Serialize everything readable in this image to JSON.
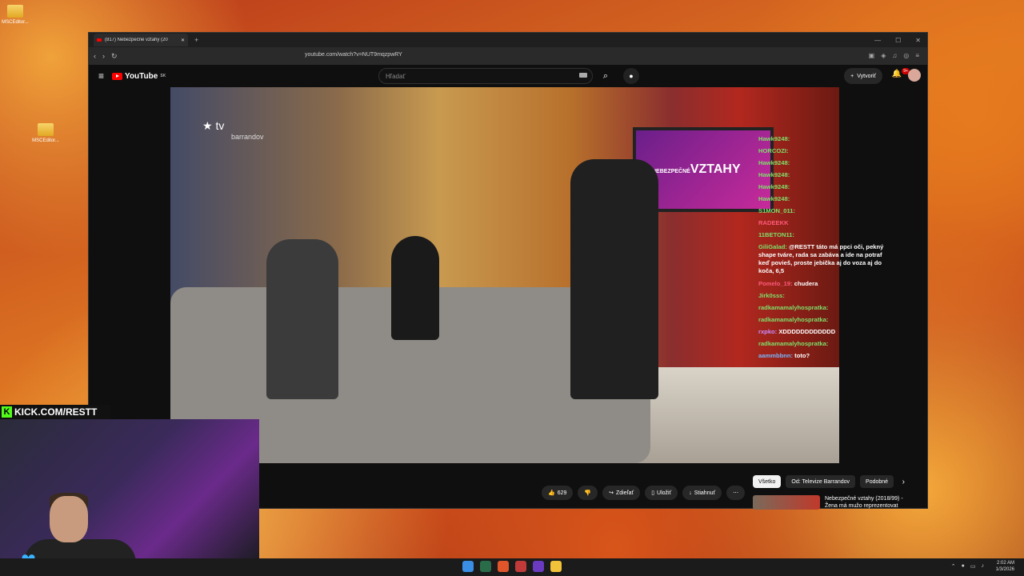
{
  "desktop": {
    "icons": [
      {
        "label": "MSCEditor..."
      },
      {
        "label": "MSCEditor..."
      }
    ]
  },
  "browser": {
    "tab_title": "(817) Nebezpečné vztahy (20",
    "url": "youtube.com/watch?v=NUT9mqzpwRY"
  },
  "youtube": {
    "logo_text": "YouTube",
    "region": "SK",
    "search_placeholder": "Hľadať",
    "create_label": "Vytvoriť",
    "notif_count": "9+",
    "video_overlay": {
      "channel_logo": "tv",
      "channel_sub": "barrandov",
      "screen_text": "VZTAHY",
      "screen_prefix": "NEBEZPEČNÉ"
    },
    "actions": {
      "likes": "629",
      "share": "Zdieľať",
      "save": "Uložiť",
      "download": "Stiahnuť"
    },
    "chips": [
      "Všetko",
      "Od: Televize Barrandov",
      "Podobné"
    ],
    "recommended": {
      "title": "Nebezpečné vztahy (2018/99) - Žena má mužo reprezentovat"
    }
  },
  "chat": [
    {
      "user": "Hawk9248:",
      "msg": "",
      "color": "green"
    },
    {
      "user": "HORCOZI:",
      "msg": "",
      "color": "green"
    },
    {
      "user": "Hawk9248:",
      "msg": "",
      "color": "green"
    },
    {
      "user": "Hawk9248:",
      "msg": "",
      "color": "green"
    },
    {
      "user": "Hawk9248:",
      "msg": "",
      "color": "green"
    },
    {
      "user": "Hawk9248:",
      "msg": "",
      "color": "green"
    },
    {
      "user": "S1MON_011:",
      "msg": "",
      "color": "green"
    },
    {
      "user": "RADEEKK",
      "msg": "",
      "color": "red"
    },
    {
      "user": "11BETON11:",
      "msg": "",
      "color": "green"
    },
    {
      "user": "GiliGalad:",
      "msg": "@RESTT táto má ppci oči, pekný shape tváre, rada sa zabáva a ide na potraf keď povieš, proste jebička aj do voza aj do koča, 6,5",
      "color": "green"
    },
    {
      "user": "Pomelo_19:",
      "msg": "chudera",
      "color": "red"
    },
    {
      "user": "Jirk0sss:",
      "msg": "",
      "color": "green"
    },
    {
      "user": "radkamamalyhospratka:",
      "msg": "",
      "color": "green"
    },
    {
      "user": "radkamamalyhospratka:",
      "msg": "",
      "color": "green"
    },
    {
      "user": "rxpko:",
      "msg": "XDDDDDDDDDDDD",
      "color": "purple"
    },
    {
      "user": "radkamamalyhospratka:",
      "msg": "",
      "color": "green"
    },
    {
      "user": "aammbbnn:",
      "msg": "toto?",
      "color": "blue"
    }
  ],
  "stream": {
    "kick_url": "KICK.COM/RESTT"
  },
  "taskbar": {
    "time": "2:02 AM",
    "date": "1/3/2026"
  }
}
